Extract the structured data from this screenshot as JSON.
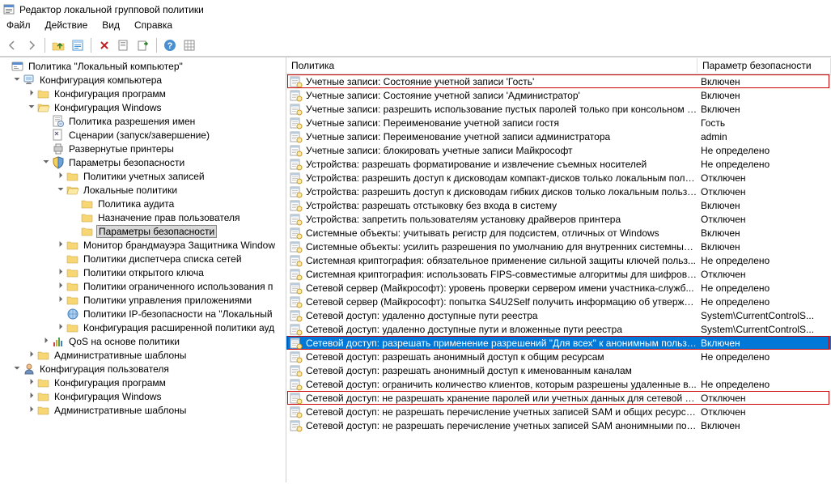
{
  "window": {
    "title": "Редактор локальной групповой политики"
  },
  "menu": {
    "file": "Файл",
    "action": "Действие",
    "view": "Вид",
    "help": "Справка"
  },
  "columns": {
    "policy": "Политика",
    "param": "Параметр безопасности"
  },
  "tree": {
    "root": "Политика \"Локальный компьютер\"",
    "comp": "Конфигурация компьютера",
    "progConf": "Конфигурация программ",
    "winConf": "Конфигурация Windows",
    "nameRes": "Политика разрешения имен",
    "scripts": "Сценарии (запуск/завершение)",
    "printers": "Развернутые принтеры",
    "secParams": "Параметры безопасности",
    "acctPol": "Политики учетных записей",
    "localPol": "Локальные политики",
    "audit": "Политика аудита",
    "userRights": "Назначение прав пользователя",
    "secOptions": "Параметры безопасности",
    "firewall": "Монитор брандмауэра Защитника Window",
    "netList": "Политики диспетчера списка сетей",
    "pubKey": "Политики открытого ключа",
    "softRestrict": "Политики ограниченного использования п",
    "appCtrl": "Политики управления приложениями",
    "ipsec": "Политики IP-безопасности на \"Локальный",
    "advAudit": "Конфигурация расширенной политики ауд",
    "qos": "QoS на основе политики",
    "adminTpl": "Административные шаблоны",
    "userConf": "Конфигурация пользователя",
    "progConf2": "Конфигурация программ",
    "winConf2": "Конфигурация Windows",
    "adminTpl2": "Административные шаблоны"
  },
  "rows": [
    {
      "p": "Учетные записи: Состояние учетной записи 'Гость'",
      "v": "Включен",
      "hl": true
    },
    {
      "p": "Учетные записи: Состояние учетной записи 'Администратор'",
      "v": "Включен"
    },
    {
      "p": "Учетные записи: разрешить использование пустых паролей только при консольном в...",
      "v": "Включен"
    },
    {
      "p": "Учетные записи: Переименование учетной записи гостя",
      "v": "Гость"
    },
    {
      "p": "Учетные записи: Переименование учетной записи администратора",
      "v": "admin"
    },
    {
      "p": "Учетные записи: блокировать учетные записи Майкрософт",
      "v": "Не определено"
    },
    {
      "p": "Устройства: разрешать форматирование и извлечение съемных носителей",
      "v": "Не определено"
    },
    {
      "p": "Устройства: разрешить доступ к дисководам компакт-дисков только локальным поль...",
      "v": "Отключен"
    },
    {
      "p": "Устройства: разрешить доступ к дисководам гибких дисков только локальным пользо...",
      "v": "Отключен"
    },
    {
      "p": "Устройства: разрешать отстыковку без входа в систему",
      "v": "Включен"
    },
    {
      "p": "Устройства: запретить пользователям установку драйверов принтера",
      "v": "Отключен"
    },
    {
      "p": "Системные объекты: учитывать регистр для подсистем, отличных от Windows",
      "v": "Включен"
    },
    {
      "p": "Системные объекты: усилить разрешения по умолчанию для внутренних системных ...",
      "v": "Включен"
    },
    {
      "p": "Системная криптография: обязательное применение сильной защиты ключей польз...",
      "v": "Не определено"
    },
    {
      "p": "Системная криптография: использовать FIPS-совместимые алгоритмы для шифрова...",
      "v": "Отключен"
    },
    {
      "p": "Сетевой сервер (Майкрософт): уровень проверки сервером имени участника-служб...",
      "v": "Не определено"
    },
    {
      "p": "Сетевой сервер (Майкрософт): попытка S4U2Self получить информацию об утвержде...",
      "v": "Не определено"
    },
    {
      "p": "Сетевой доступ: удаленно доступные пути реестра",
      "v": "System\\CurrentControlS..."
    },
    {
      "p": "Сетевой доступ: удаленно доступные пути и вложенные пути реестра",
      "v": "System\\CurrentControlS..."
    },
    {
      "p": "Сетевой доступ: разрешать применение разрешений \"Для всех\" к анонимным пользо...",
      "v": "Включен",
      "sel": true,
      "hl": true
    },
    {
      "p": "Сетевой доступ: разрешать анонимный доступ к общим ресурсам",
      "v": "Не определено"
    },
    {
      "p": "Сетевой доступ: разрешать анонимный доступ к именованным каналам",
      "v": ""
    },
    {
      "p": "Сетевой доступ: ограничить количество клиентов, которым разрешены удаленные в...",
      "v": "Не определено"
    },
    {
      "p": "Сетевой доступ: не разрешать хранение паролей или учетных данных для сетевой про...",
      "v": "Отключен",
      "hl": true
    },
    {
      "p": "Сетевой доступ: не разрешать перечисление учетных записей SAM и общих ресурсов ...",
      "v": "Отключен"
    },
    {
      "p": "Сетевой доступ: не разрешать перечисление учетных записей SAM анонимными поль...",
      "v": "Включен"
    }
  ]
}
